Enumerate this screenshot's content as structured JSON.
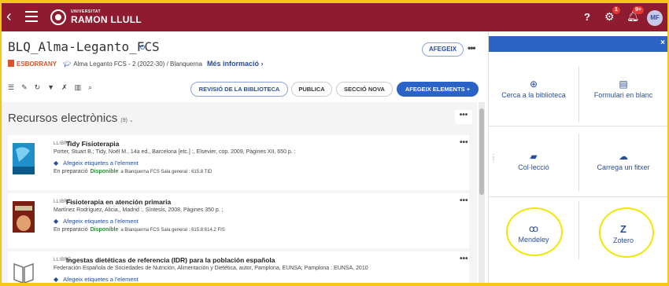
{
  "topbar": {
    "university_small": "UNIVERSITAT",
    "university_name": "RAMON LLULL",
    "help": "?",
    "settings_badge": "1",
    "notifications_badge": "9+",
    "avatar": "MF"
  },
  "header": {
    "title": "BLQ_Alma-Leganto_FCS",
    "add_button": "AFEGEIX",
    "more": "•••",
    "status": "ESBORRANY",
    "course": "Alma Leganto FCS - 2 (2022-30) / Blanquerna",
    "more_info": "Més informació ›"
  },
  "toolbar": {
    "buttons": [
      "REVISIÓ DE LA BIBLIOTECA",
      "PUBLICA",
      "SECCIÓ NOVA",
      "AFEGEIX ELEMENTS  +"
    ]
  },
  "section": {
    "title": "Recursos electrònics",
    "count": "(9)",
    "more": "•••"
  },
  "items": [
    {
      "type": "LLIBRE",
      "title": "Tidy Fisioterapia",
      "details": "Porter, Stuart B.; Tidy, Noël M., 14a ed., Barcelona [etc.] :, Elsevier, cop. 2009, Pàgines XII, 650 p. :",
      "tag": "Afegeix etiquetes a l'element",
      "status": "En preparació",
      "availability": "Disponible",
      "location": "a Blanquerna FCS Sala general : 615.8 TID",
      "more": "•••"
    },
    {
      "type": "LLIBRE",
      "title": "Fisioterapia en atención primaria",
      "details": "Martínez Rodríguez, Alicia., Madrid :, Síntesis, 2008, Pàgines 350 p. ;",
      "tag": "Afegeix etiquetes a l'element",
      "status": "En preparació",
      "availability": "Disponible",
      "location": "a Blanquerna FCS Sala general : 615.8:614.2 FIS",
      "more": "•••"
    },
    {
      "type": "LLIBRE",
      "title": "Ingestas dietéticas de referencia (IDR) para la población española",
      "details": "Federación Española de Sociedades de Nutrición, Alimentación y Dietética, autor, Pamplona, EUNSA; Pamplona : EUNSA, 2010",
      "tag": "Afegeix etiquetes a l'element",
      "status": "",
      "availability": "",
      "location": "",
      "more": "•••"
    }
  ],
  "panel": {
    "close": "×",
    "options": [
      {
        "label": "Cerca a la biblioteca",
        "icon": "⊕"
      },
      {
        "label": "Formulari en blanc",
        "icon": "▤"
      },
      {
        "label": "Col·lecció",
        "icon": "▰"
      },
      {
        "label": "Carrega un fitxer",
        "icon": "☁"
      },
      {
        "label": "Mendeley",
        "icon": "ꝏ"
      },
      {
        "label": "Zotero",
        "icon": "Z"
      }
    ]
  },
  "colors": {
    "brand": "#8e1b2f",
    "accent": "#2a62c5",
    "highlight": "#f2e600",
    "available": "#2e8b3a",
    "draft": "#d9542b"
  }
}
